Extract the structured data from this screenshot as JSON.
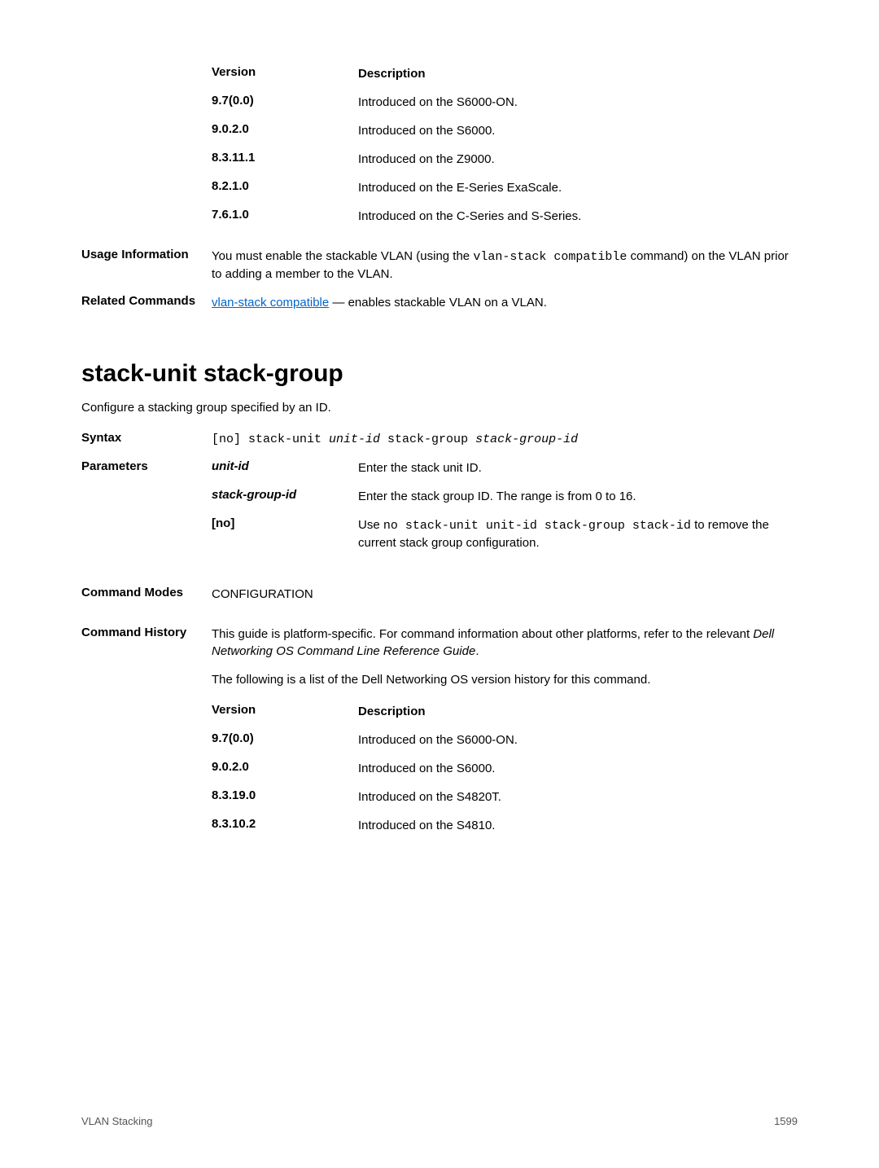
{
  "top_table": {
    "headers": {
      "version": "Version",
      "description": "Description"
    },
    "rows": [
      {
        "version": "9.7(0.0)",
        "description": "Introduced on the S6000-ON."
      },
      {
        "version": "9.0.2.0",
        "description": "Introduced on the S6000."
      },
      {
        "version": "8.3.11.1",
        "description": "Introduced on the Z9000."
      },
      {
        "version": "8.2.1.0",
        "description": "Introduced on the E-Series ExaScale."
      },
      {
        "version": "7.6.1.0",
        "description": "Introduced on the C-Series and S-Series."
      }
    ]
  },
  "usage": {
    "label": "Usage Information",
    "text_pre": "You must enable the stackable VLAN (using the ",
    "code": "vlan-stack compatible",
    "text_post": " command) on the VLAN prior to adding a member to the VLAN."
  },
  "related": {
    "label": "Related Commands",
    "link": "vlan-stack compatible",
    "after": " — enables stackable VLAN on a VLAN."
  },
  "section": {
    "heading": "stack-unit stack-group",
    "intro": "Configure a stacking group specified by an ID."
  },
  "syntax": {
    "label": "Syntax",
    "pre": "[no] stack-unit ",
    "arg1": "unit-id",
    "mid": " stack-group ",
    "arg2": "stack-group-id"
  },
  "parameters": {
    "label": "Parameters",
    "rows": [
      {
        "name": "unit-id",
        "name_italic": true,
        "desc": "Enter the stack unit ID."
      },
      {
        "name": "stack-group-id",
        "name_italic": true,
        "desc": "Enter the stack group ID. The range is from 0 to 16."
      }
    ],
    "no_row": {
      "name": "[no]",
      "pre": "Use ",
      "code": "no stack-unit unit-id stack-group stack-id",
      "post": " to remove the current stack group configuration."
    }
  },
  "cmd_modes": {
    "label": "Command Modes",
    "value": "CONFIGURATION"
  },
  "cmd_history": {
    "label": "Command History",
    "para1_pre": "This guide is platform-specific. For command information about other platforms, refer to the relevant ",
    "para1_italic": "Dell Networking OS Command Line Reference Guide",
    "para1_post": ".",
    "para2": "The following is a list of the Dell Networking OS version history for this command.",
    "headers": {
      "version": "Version",
      "description": "Description"
    },
    "rows": [
      {
        "version": "9.7(0.0)",
        "description": "Introduced on the S6000-ON."
      },
      {
        "version": "9.0.2.0",
        "description": "Introduced on the S6000."
      },
      {
        "version": "8.3.19.0",
        "description": "Introduced on the S4820T."
      },
      {
        "version": "8.3.10.2",
        "description": "Introduced on the S4810."
      }
    ]
  },
  "footer": {
    "left": "VLAN Stacking",
    "right": "1599"
  }
}
